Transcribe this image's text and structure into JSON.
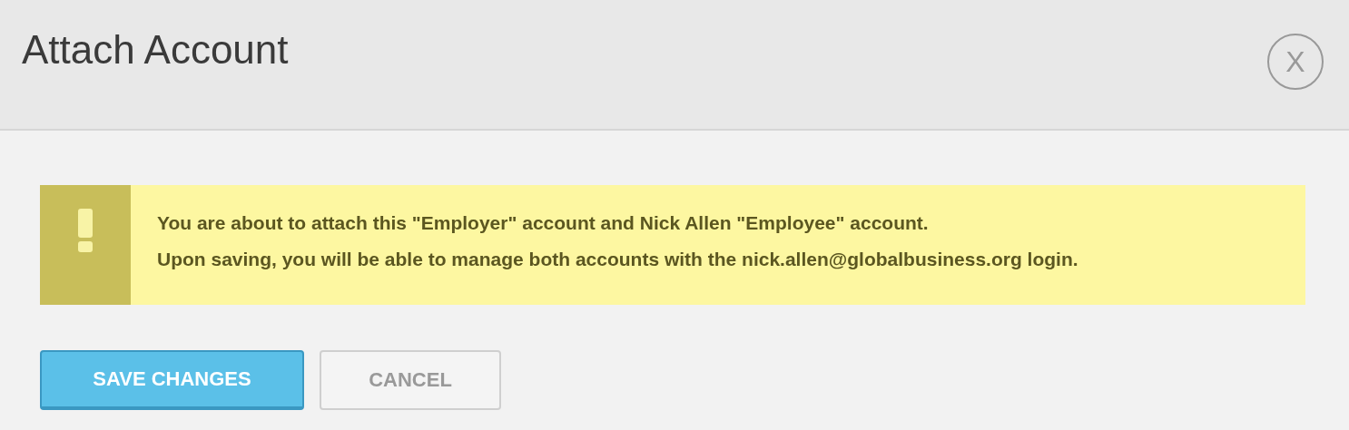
{
  "dialog": {
    "title": "Attach Account",
    "close": "X"
  },
  "alert": {
    "kind": "warning",
    "lines": [
      "You are about to attach this \"Employer\" account and Nick Allen \"Employee\" account.",
      "Upon saving, you will be able to manage both accounts with the nick.allen@globalbusiness.org login."
    ]
  },
  "buttons": [
    {
      "label": "SAVE CHANGES",
      "kind": "primary"
    },
    {
      "label": "CANCEL",
      "kind": "secondary"
    }
  ]
}
